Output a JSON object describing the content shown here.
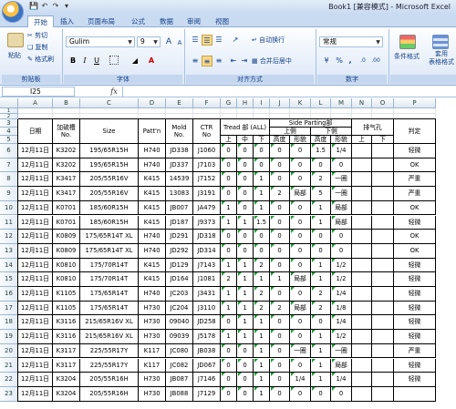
{
  "window": {
    "title": "Book1  [兼容模式] - Microsoft Excel",
    "quick_access": [
      "save-icon",
      "undo-icon",
      "redo-icon",
      "customize-icon"
    ]
  },
  "tabs": [
    {
      "label": "开始",
      "active": true
    },
    {
      "label": "插入",
      "active": false
    },
    {
      "label": "页面布局",
      "active": false
    },
    {
      "label": "公式",
      "active": false
    },
    {
      "label": "数据",
      "active": false
    },
    {
      "label": "审阅",
      "active": false
    },
    {
      "label": "视图",
      "active": false
    }
  ],
  "ribbon": {
    "clipboard": {
      "paste": "粘贴",
      "cut": "剪切",
      "copy": "复制",
      "format_painter": "格式刷",
      "label": "剪贴板"
    },
    "font": {
      "name": "Gulim",
      "size": "9",
      "bold": "B",
      "italic": "I",
      "underline": "U",
      "grow": "A",
      "shrink": "A",
      "label": "字体"
    },
    "alignment": {
      "wrap": "自动换行",
      "merge": "合并后居中",
      "label": "对齐方式"
    },
    "number": {
      "format": "常规",
      "percent": "%",
      "comma": ",",
      "label": "数字"
    },
    "styles": {
      "conditional": "条件格式",
      "table": "套用\n表格格式"
    }
  },
  "formula_bar": {
    "cell_ref": "I25",
    "fx": "fx",
    "content": ""
  },
  "colors": {
    "accent": "#15428b",
    "ribbon": "#dbe7f6",
    "header": "#dfe7f1",
    "green_tick": "#1c9a3a"
  },
  "sheet": {
    "columns": [
      "A",
      "B",
      "C",
      "D",
      "E",
      "F",
      "G",
      "H",
      "I",
      "J",
      "K",
      "L",
      "M",
      "N",
      "O",
      "P"
    ],
    "row_numbers": [
      "1",
      "2",
      "3",
      "4",
      "5",
      "6",
      "7",
      "8",
      "9",
      "10",
      "11",
      "12",
      "13",
      "14",
      "15",
      "16",
      "17",
      "18",
      "19",
      "20",
      "21",
      "22",
      "23"
    ],
    "headers": {
      "date": "日期",
      "batch": "加硫槽\nNo.",
      "size": "Size",
      "pattern": "Patt'n",
      "mold": "Mold\nNo.",
      "ctr": "CTR\nNo",
      "tread": "Tread 部 (ALL)",
      "tread_sub": [
        "上",
        "中",
        "下"
      ],
      "side": "Side Parting部",
      "side_up": "上侧",
      "side_down": "下侧",
      "side_sub": [
        "高度",
        "形貌",
        "高度",
        "形貌"
      ],
      "vent": "排气孔",
      "vent_sub": [
        "上",
        "下"
      ],
      "judge": "判定"
    },
    "rows": [
      [
        "12月11日",
        "K3202",
        "195/65R15H",
        "H740",
        "JD338",
        "J1060",
        "0",
        "0",
        "0",
        "0",
        "0",
        "1.5",
        "1/4",
        "",
        "",
        "轻微"
      ],
      [
        "12月11日",
        "K3202",
        "195/65R15H",
        "H740",
        "JD337",
        "J7103",
        "0",
        "0",
        "0",
        "0",
        "0",
        "0",
        "0",
        "",
        "",
        "OK"
      ],
      [
        "12月11日",
        "K3417",
        "205/55R16V",
        "K415",
        "14539",
        "J7152",
        "0",
        "0",
        "1",
        "0",
        "0",
        "2",
        "一圈",
        "",
        "",
        "严重"
      ],
      [
        "12月11日",
        "K3417",
        "205/55R16V",
        "K415",
        "13083",
        "J3191",
        "0",
        "0",
        "1",
        "2",
        "局部",
        "5",
        "一圈",
        "",
        "",
        "严重"
      ],
      [
        "12月11日",
        "K0701",
        "185/60R15H",
        "K415",
        "JB007",
        "JA479",
        "1",
        "0",
        "1",
        "0",
        "0",
        "1",
        "局部",
        "",
        "",
        "OK"
      ],
      [
        "12月11日",
        "K0701",
        "185/60R15H",
        "K415",
        "JD187",
        "J9373",
        "1",
        "1",
        "1.5",
        "0",
        "0",
        "1",
        "局部",
        "",
        "",
        "轻微"
      ],
      [
        "12月11日",
        "K0809",
        "175/65R14T XL",
        "H740",
        "JD291",
        "JD318",
        "0",
        "0",
        "0",
        "0",
        "0",
        "0",
        "0",
        "",
        "",
        "OK"
      ],
      [
        "12月11日",
        "K0809",
        "175/65R14T XL",
        "H740",
        "JD292",
        "JD314",
        "0",
        "0",
        "0",
        "0",
        "0",
        "0",
        "0",
        "",
        "",
        "OK"
      ],
      [
        "12月11日",
        "K0810",
        "175/70R14T",
        "K415",
        "JD129",
        "J7143",
        "1",
        "1",
        "2",
        "0",
        "0",
        "1",
        "1/2",
        "",
        "",
        "轻微"
      ],
      [
        "12月11日",
        "K0810",
        "175/70R14T",
        "K415",
        "JD164",
        "J1081",
        "2",
        "1",
        "1",
        "1",
        "局部",
        "1",
        "1/2",
        "",
        "",
        "轻微"
      ],
      [
        "12月11日",
        "K1105",
        "175/65R14T",
        "H740",
        "JC203",
        "J3431",
        "1",
        "1",
        "2",
        "0",
        "0",
        "2",
        "1/4",
        "",
        "",
        "轻微"
      ],
      [
        "12月11日",
        "K1105",
        "175/65R14T",
        "H730",
        "JC204",
        "J3110",
        "1",
        "1",
        "2",
        "2",
        "局部",
        "2",
        "1/8",
        "",
        "",
        "轻微"
      ],
      [
        "12月11日",
        "K3116",
        "215/65R16V XL",
        "H730",
        "09040",
        "JD258",
        "0",
        "1",
        "1",
        "0",
        "0",
        "0",
        "1/4",
        "",
        "",
        "轻微"
      ],
      [
        "12月11日",
        "K3116",
        "215/65R16V XL",
        "H730",
        "09039",
        "J5178",
        "1",
        "1",
        "1",
        "0",
        "0",
        "1",
        "1/2",
        "",
        "",
        "轻微"
      ],
      [
        "12月11日",
        "K3117",
        "225/55R17Y",
        "K117",
        "JC080",
        "JB038",
        "0",
        "0",
        "1",
        "0",
        "一圈",
        "1",
        "一圈",
        "",
        "",
        "严重"
      ],
      [
        "12月11日",
        "K3117",
        "225/55R17Y",
        "K117",
        "JC082",
        "JD067",
        "0",
        "0",
        "1",
        "0",
        "0",
        "1",
        "局部",
        "",
        "",
        "轻微"
      ],
      [
        "12月11日",
        "K3204",
        "205/55R16H",
        "H730",
        "JB087",
        "J7146",
        "0",
        "0",
        "1",
        "0",
        "1/4",
        "1",
        "1/4",
        "",
        "",
        "轻微"
      ],
      [
        "12月11日",
        "K3204",
        "205/55R16H",
        "H730",
        "JB088",
        "J7129",
        "0",
        "0",
        "1",
        "0",
        "0",
        "0",
        "0",
        "",
        "",
        ""
      ]
    ]
  }
}
